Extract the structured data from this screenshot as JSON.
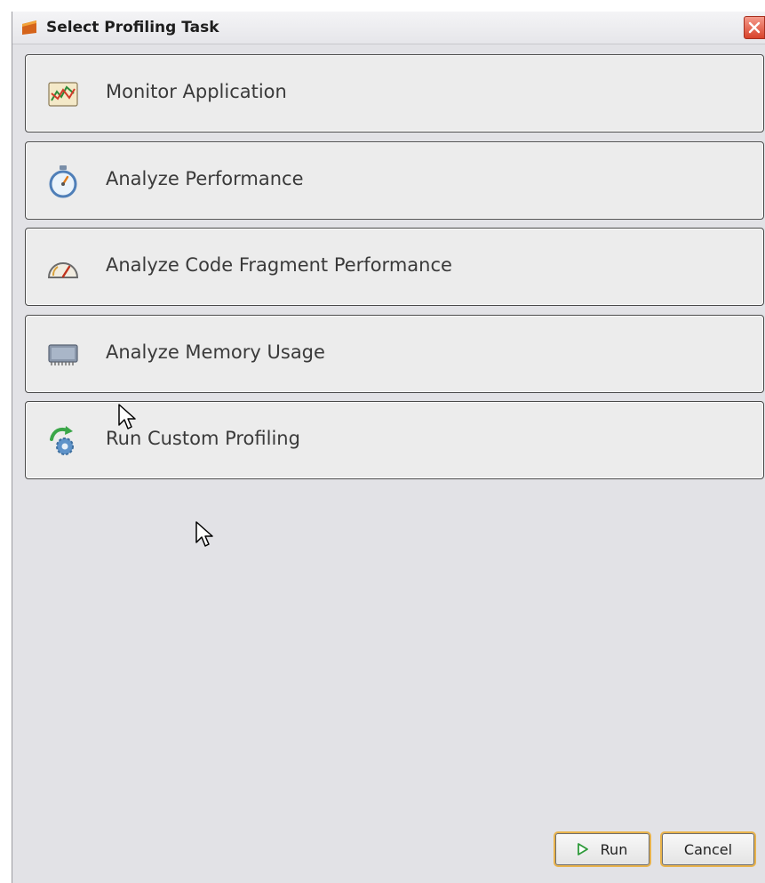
{
  "dialog": {
    "title": "Select Profiling Task"
  },
  "tasks": [
    {
      "label": "Monitor Application",
      "icon": "monitor-chart-icon"
    },
    {
      "label": "Analyze Performance",
      "icon": "stopwatch-icon"
    },
    {
      "label": "Analyze Code Fragment Performance",
      "icon": "gauge-icon"
    },
    {
      "label": "Analyze Memory Usage",
      "icon": "memory-chip-icon"
    },
    {
      "label": "Run Custom Profiling",
      "icon": "custom-gear-icon"
    }
  ],
  "buttons": {
    "run": "Run",
    "cancel": "Cancel"
  },
  "colors": {
    "dialog_background": "#e2e2e6",
    "task_background": "#ececec",
    "focus_outline": "#e9b34c",
    "close_button": "#d8432b"
  }
}
